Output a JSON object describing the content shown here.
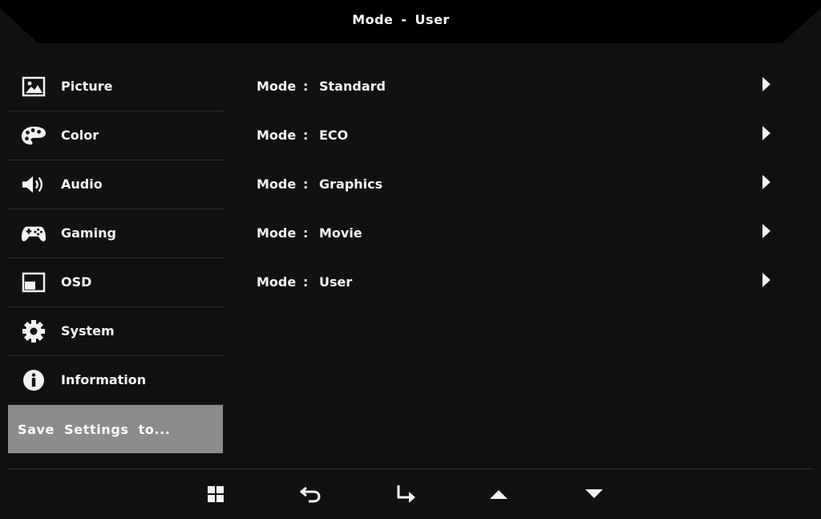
{
  "header": {
    "title_left": "Mode",
    "title_sep": "-",
    "title_right": "User"
  },
  "sidebar": {
    "items": [
      {
        "label": "Picture",
        "icon": "picture-icon"
      },
      {
        "label": "Color",
        "icon": "palette-icon"
      },
      {
        "label": "Audio",
        "icon": "speaker-icon"
      },
      {
        "label": "Gaming",
        "icon": "gamepad-icon"
      },
      {
        "label": "OSD",
        "icon": "osd-icon"
      },
      {
        "label": "System",
        "icon": "gear-icon"
      },
      {
        "label": "Information",
        "icon": "info-icon"
      }
    ],
    "save_label": "Save Settings to..."
  },
  "modes": [
    {
      "label": "Mode",
      "colon": ":",
      "value": "Standard"
    },
    {
      "label": "Mode",
      "colon": ":",
      "value": "ECO"
    },
    {
      "label": "Mode",
      "colon": ":",
      "value": "Graphics"
    },
    {
      "label": "Mode",
      "colon": ":",
      "value": "Movie"
    },
    {
      "label": "Mode",
      "colon": ":",
      "value": "User"
    }
  ],
  "nav_icons": [
    "menu-grid-icon",
    "back-return-icon",
    "enter-icon",
    "up-arrow-icon",
    "down-arrow-icon"
  ],
  "colors": {
    "background": "#111111",
    "selected": "#8c8c8c",
    "text": "#f4f4f4"
  }
}
